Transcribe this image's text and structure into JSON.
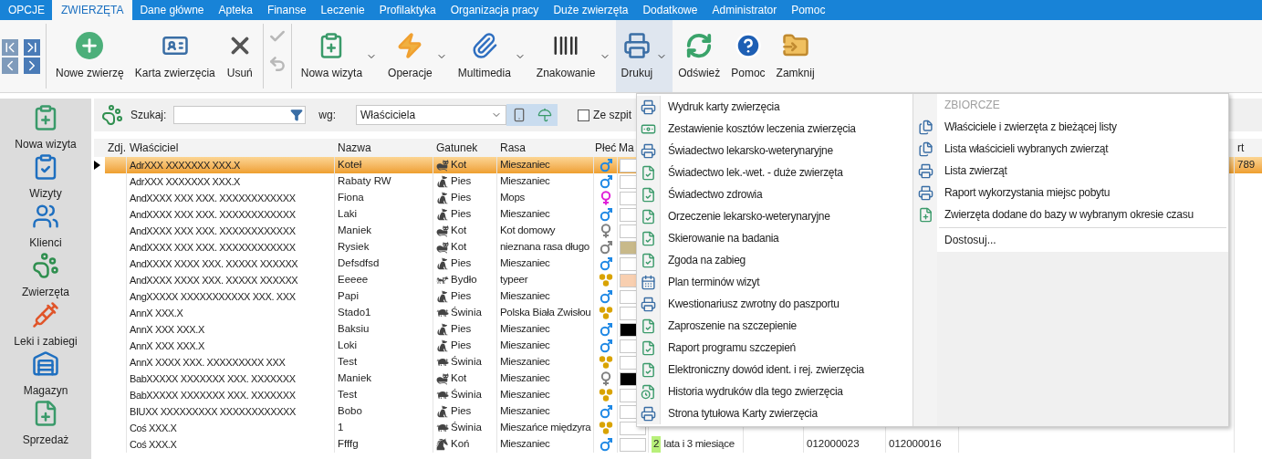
{
  "menu_bar": [
    {
      "label": "OPCJE",
      "selected": false
    },
    {
      "label": "ZWIERZĘTA",
      "selected": true
    },
    {
      "label": "Dane główne",
      "selected": false
    },
    {
      "label": "Apteka",
      "selected": false
    },
    {
      "label": "Finanse",
      "selected": false
    },
    {
      "label": "Leczenie",
      "selected": false
    },
    {
      "label": "Profilaktyka",
      "selected": false
    },
    {
      "label": "Organizacja pracy",
      "selected": false
    },
    {
      "label": "Duże zwierzęta",
      "selected": false
    },
    {
      "label": "Dodatkowe",
      "selected": false
    },
    {
      "label": "Administrator",
      "selected": false
    },
    {
      "label": "Pomoc",
      "selected": false
    }
  ],
  "ribbon": {
    "record_group": [
      {
        "label": "Nowe zwierzę"
      },
      {
        "label": "Karta zwierzęcia"
      },
      {
        "label": "Usuń"
      }
    ],
    "edit_group": [
      {
        "disabled": true
      },
      {
        "disabled": true
      }
    ],
    "actions": [
      {
        "label": "Nowa wizyta",
        "has_menu": true,
        "pressed": false
      },
      {
        "label": "Operacje",
        "has_menu": true,
        "pressed": false
      },
      {
        "label": "Multimedia",
        "has_menu": true,
        "pressed": false
      },
      {
        "label": "Znakowanie",
        "has_menu": true,
        "pressed": false
      },
      {
        "label": "Drukuj",
        "has_menu": true,
        "pressed": true
      },
      {
        "label": "Odśwież",
        "has_menu": false,
        "pressed": false
      },
      {
        "label": "Pomoc",
        "has_menu": false,
        "pressed": false
      },
      {
        "label": "Zamknij",
        "has_menu": false,
        "pressed": false
      }
    ]
  },
  "sidebar": {
    "items": [
      {
        "label": "Nowa wizyta"
      },
      {
        "label": "Wizyty"
      },
      {
        "label": "Klienci"
      },
      {
        "label": "Zwierzęta"
      },
      {
        "label": "Leki i zabiegi"
      },
      {
        "label": "Magazyn"
      },
      {
        "label": "Sprzedaż"
      }
    ]
  },
  "search": {
    "label": "Szukaj:",
    "by_label": "wg:",
    "by_value": "Właściciela",
    "checkbox": {
      "label": "Ze szpit",
      "checked": false
    }
  },
  "table": {
    "columns": [
      "Zdj.",
      "Właściciel",
      "Nazwa",
      "Gatunek",
      "Rasa",
      "Płeć",
      "Ma",
      "rt"
    ],
    "rows": [
      {
        "selected": true,
        "owner": "AdrXXX XXXXXXX XXX.X",
        "name": "Koteł",
        "species": {
          "label": "Kot",
          "kind": "cat"
        },
        "breed": "Mieszaniec",
        "sex": {
          "kind": "male"
        },
        "color": "#ffffff",
        "last": "789"
      },
      {
        "selected": false,
        "owner": "AdrXXX XXXXXXX XXX.X",
        "name": "Rabaty RW",
        "species": {
          "label": "Pies",
          "kind": "dog"
        },
        "breed": "Mieszaniec",
        "sex": {
          "kind": "male"
        },
        "color": "#ffffff"
      },
      {
        "selected": false,
        "owner": "AndXXXX XXX XXX. XXXXXXXXXXXX",
        "name": "Fiona",
        "species": {
          "label": "Pies",
          "kind": "dog"
        },
        "breed": "Mops",
        "sex": {
          "kind": "female"
        },
        "color": "#ffffff"
      },
      {
        "selected": false,
        "owner": "AndXXXX XXX XXX. XXXXXXXXXXXX",
        "name": "Laki",
        "species": {
          "label": "Pies",
          "kind": "dog"
        },
        "breed": "Mieszaniec",
        "sex": {
          "kind": "male"
        },
        "color": "#ffffff"
      },
      {
        "selected": false,
        "owner": "AndXXXX XXX XXX. XXXXXXXXXXXX",
        "name": "Maniek",
        "species": {
          "label": "Kot",
          "kind": "cat"
        },
        "breed": "Kot domowy",
        "sex": {
          "kind": "femaleneutral"
        },
        "color": "#ffffff"
      },
      {
        "selected": false,
        "owner": "AndXXXX XXX XXX. XXXXXXXXXXXX",
        "name": "Rysiek",
        "species": {
          "label": "Kot",
          "kind": "cat"
        },
        "breed": "nieznana rasa długo",
        "sex": {
          "kind": "maleneutral"
        },
        "color": "#c8b98a"
      },
      {
        "selected": false,
        "owner": "AndXXXX XXXX XXX. XXXXX XXXXXX",
        "name": "Defsdfsd",
        "species": {
          "label": "Pies",
          "kind": "dog"
        },
        "breed": "Mieszaniec",
        "sex": {
          "kind": "male"
        },
        "color": "#ffffff"
      },
      {
        "selected": false,
        "owner": "AndXXXX XXXX XXX. XXXXX XXXXXX",
        "name": "Eeeee",
        "species": {
          "label": "Bydło",
          "kind": "cow"
        },
        "breed": "typeer",
        "sex": {
          "kind": "herd"
        },
        "color": "#f8cfb0"
      },
      {
        "selected": false,
        "owner": "AngXXXXX XXXXXXXXXXX XXX. XXX",
        "name": "Papi",
        "species": {
          "label": "Pies",
          "kind": "dog"
        },
        "breed": "Mieszaniec",
        "sex": {
          "kind": "male"
        },
        "color": "#ffffff"
      },
      {
        "selected": false,
        "owner": "AnnX XXX.X",
        "name": "Stado1",
        "species": {
          "label": "Świnia",
          "kind": "pig"
        },
        "breed": "Polska Biała Zwisłou",
        "sex": {
          "kind": "herd"
        },
        "color": "#ffffff"
      },
      {
        "selected": false,
        "owner": "AnnX XXX XXX.X",
        "name": "Baksiu",
        "species": {
          "label": "Pies",
          "kind": "dog"
        },
        "breed": "Mieszaniec",
        "sex": {
          "kind": "male"
        },
        "color": "#000000"
      },
      {
        "selected": false,
        "owner": "AnnX XXX XXX.X",
        "name": "Loki",
        "species": {
          "label": "Pies",
          "kind": "dog"
        },
        "breed": "Mieszaniec",
        "sex": {
          "kind": "male"
        },
        "color": "#ffffff"
      },
      {
        "selected": false,
        "owner": "AnnX XXXX XXX. XXXXXXXXX XXX",
        "name": "Test",
        "species": {
          "label": "Świnia",
          "kind": "pig"
        },
        "breed": "Mieszaniec",
        "sex": {
          "kind": "herd"
        },
        "color": "#ffffff"
      },
      {
        "selected": false,
        "owner": "BabXXXXX XXXXXXX XXX. XXXXXXX",
        "name": "Maniek",
        "species": {
          "label": "Kot",
          "kind": "cat"
        },
        "breed": "Mieszaniec",
        "sex": {
          "kind": "femaleneutral"
        },
        "color": "#000000"
      },
      {
        "selected": false,
        "owner": "BabXXXXX XXXXXXX XXX. XXXXXXX",
        "name": "Test",
        "species": {
          "label": "Świnia",
          "kind": "pig"
        },
        "breed": "Mieszaniec",
        "sex": {
          "kind": "herd"
        },
        "color": "#ffffff"
      },
      {
        "selected": false,
        "owner": "BIUXX XXXXXXXXX XXXXXXXXXXXX",
        "name": "Bobo",
        "species": {
          "label": "Pies",
          "kind": "dog"
        },
        "breed": "Mieszaniec",
        "sex": {
          "kind": "male"
        },
        "color": "#ffffff"
      },
      {
        "selected": false,
        "owner": "Coś XXX.X",
        "name": "1",
        "species": {
          "label": "Świnia",
          "kind": "pig"
        },
        "breed": "Mieszańce międzyra",
        "sex": {
          "kind": "herd"
        },
        "color": "#ffffff"
      },
      {
        "selected": false,
        "owner": "Coś XXX.X",
        "name": "Ffffg",
        "species": {
          "label": "Koń",
          "kind": "horse"
        },
        "breed": "Mieszaniec",
        "sex": {
          "kind": "male"
        },
        "color": "#ffffff",
        "age_number": "2",
        "age_text": "lata i 3 miesiące",
        "number_1": "012000023",
        "number_2": "012000016"
      }
    ]
  },
  "print_menu": {
    "items": [
      {
        "label": "Wydruk karty zwierzęcia",
        "kind": "printer"
      },
      {
        "label": "Zestawienie kosztów leczenia zwierzęcia",
        "kind": "costs"
      },
      {
        "label": "Świadectwo lekarsko-weterynaryjne",
        "kind": "printer"
      },
      {
        "label": "Świadectwo lek.-wet. - duże zwierzęta",
        "kind": "document"
      },
      {
        "label": "Świadectwo zdrowia",
        "kind": "document"
      },
      {
        "label": "Orzeczenie lekarsko-weterynaryjne",
        "kind": "document"
      },
      {
        "label": "Skierowanie na badania",
        "kind": "document"
      },
      {
        "label": "Zgoda na zabieg",
        "kind": "document"
      },
      {
        "label": "Plan terminów wizyt",
        "kind": "calendar"
      },
      {
        "label": "Kwestionariusz zwrotny do paszportu",
        "kind": "printer"
      },
      {
        "label": "Zaproszenie na szczepienie",
        "kind": "document"
      },
      {
        "label": "Raport programu szczepień",
        "kind": "document"
      },
      {
        "label": "Elektroniczny dowód ident. i rej. zwierzęcia",
        "kind": "document"
      },
      {
        "label": "Historia wydruków dla tego zwierzęcia",
        "kind": "history"
      },
      {
        "label": "Strona tytułowa Karty zwierzęcia",
        "kind": "printer"
      }
    ],
    "group_title": "ZBIORCZE",
    "group_items": [
      {
        "label": "Właściciele i zwierzęta z bieżącej listy",
        "kind": "list"
      },
      {
        "label": "Lista właścicieli wybranych zwierząt",
        "kind": "list"
      },
      {
        "label": "Lista zwierząt",
        "kind": "printer"
      },
      {
        "label": "Raport wykorzystania miejsc pobytu",
        "kind": "printer"
      },
      {
        "label": "Zwierzęta dodane do bazy w wybranym okresie czasu",
        "kind": "add"
      }
    ],
    "customize": "Dostosuj..."
  }
}
